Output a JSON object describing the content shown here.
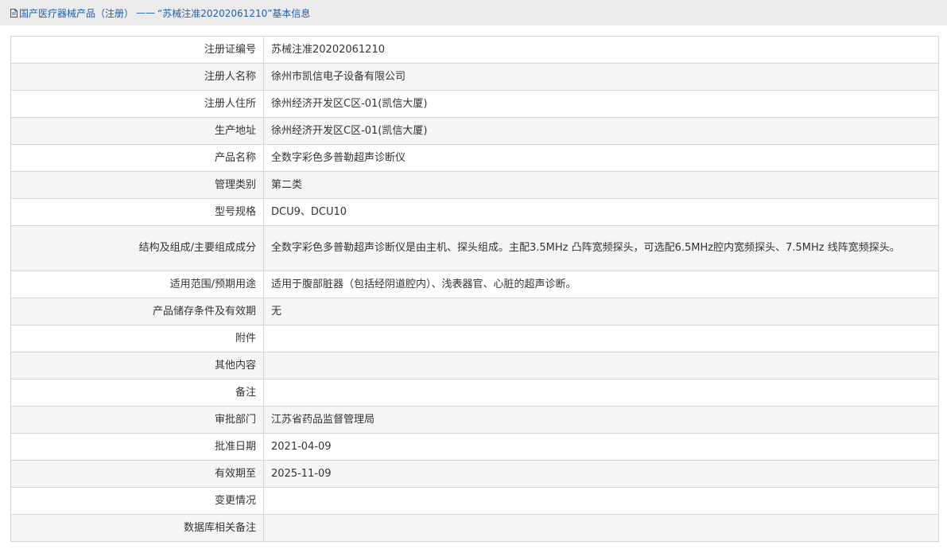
{
  "breadcrumb": {
    "link_label": "国产医疗器械产品（注册）",
    "separator": "——",
    "current": "“苏械注准20202061210”基本信息"
  },
  "rows": [
    {
      "label": "注册证编号",
      "value": "苏械注准20202061210"
    },
    {
      "label": "注册人名称",
      "value": "徐州市凯信电子设备有限公司"
    },
    {
      "label": "注册人住所",
      "value": "徐州经济开发区C区-01(凯信大厦)"
    },
    {
      "label": "生产地址",
      "value": "徐州经济开发区C区-01(凯信大厦)"
    },
    {
      "label": "产品名称",
      "value": "全数字彩色多普勒超声诊断仪"
    },
    {
      "label": "管理类别",
      "value": "第二类"
    },
    {
      "label": "型号规格",
      "value": "DCU9、DCU10"
    },
    {
      "label": "结构及组成/主要组成成分",
      "value": "全数字彩色多普勒超声诊断仪是由主机、探头组成。主配3.5MHz 凸阵宽频探头，可选配6.5MHz腔内宽频探头、7.5MHz 线阵宽频探头。"
    },
    {
      "label": "适用范围/预期用途",
      "value": "适用于腹部脏器（包括经阴道腔内）、浅表器官、心脏的超声诊断。"
    },
    {
      "label": "产品储存条件及有效期",
      "value": "无"
    },
    {
      "label": "附件",
      "value": ""
    },
    {
      "label": "其他内容",
      "value": ""
    },
    {
      "label": "备注",
      "value": ""
    },
    {
      "label": "审批部门",
      "value": "江苏省药品监督管理局"
    },
    {
      "label": "批准日期",
      "value": "2021-04-09"
    },
    {
      "label": "有效期至",
      "value": "2025-11-09"
    },
    {
      "label": "变更情况",
      "value": ""
    },
    {
      "label": "数据库相关备注",
      "value": ""
    }
  ],
  "colors": {
    "link": "#1f5fb0",
    "header_bg": "#ebebeb",
    "row_alt_bg": "#f5f5f5",
    "border": "#d4d4d4"
  }
}
